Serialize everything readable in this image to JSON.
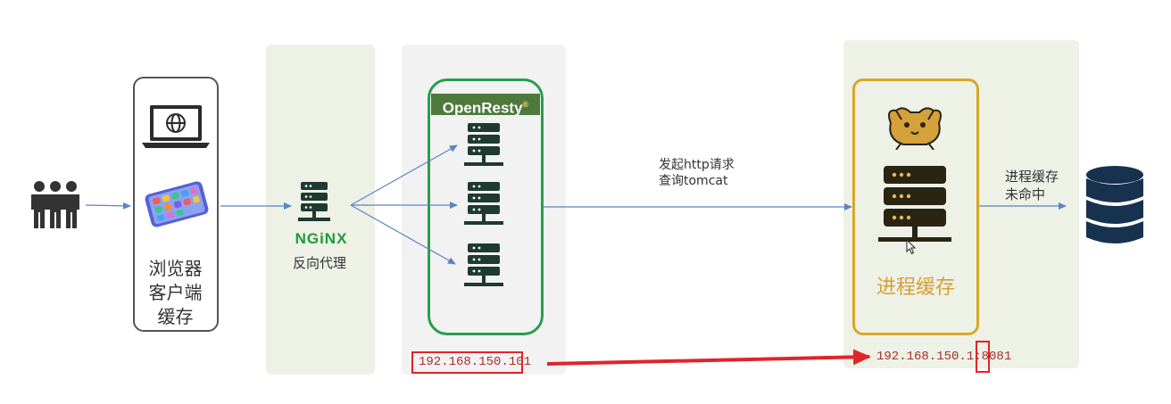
{
  "browser": {
    "label_lines": [
      "浏览器",
      "客户端",
      "缓存"
    ]
  },
  "nginx": {
    "logo_text": "NGiNX",
    "label": "反向代理"
  },
  "openresty": {
    "logo_text": "OpenResty",
    "logo_mark": "®",
    "ip": "192.168.150.101"
  },
  "request": {
    "line1": "发起http请求",
    "line2": "查询tomcat"
  },
  "tomcat": {
    "label": "进程缓存",
    "ip": "192.168.150.1:8081"
  },
  "miss": {
    "line1": "进程缓存",
    "line2": "未命中"
  },
  "colors": {
    "panel_green": "#edf1e6",
    "panel_grey": "#f2f2f2",
    "server_dark": "#1f3a31",
    "server_gold": "#2a2414",
    "openresty_border": "#2a9d4e",
    "openresty_header": "#4d7a3c",
    "tomcat_border": "#d9a62a",
    "tomcat_text": "#d6a12e",
    "arrow_blue": "#5b84c4",
    "arrow_red": "#e0242b",
    "ip_text": "#a5302a",
    "db_navy": "#16324f",
    "nginx_green": "#1f9a3a"
  },
  "icons": [
    "users-icon",
    "laptop-icon",
    "globe-icon",
    "phone-icon",
    "server-icon",
    "tomcat-cat-icon",
    "database-icon",
    "cursor-icon"
  ]
}
